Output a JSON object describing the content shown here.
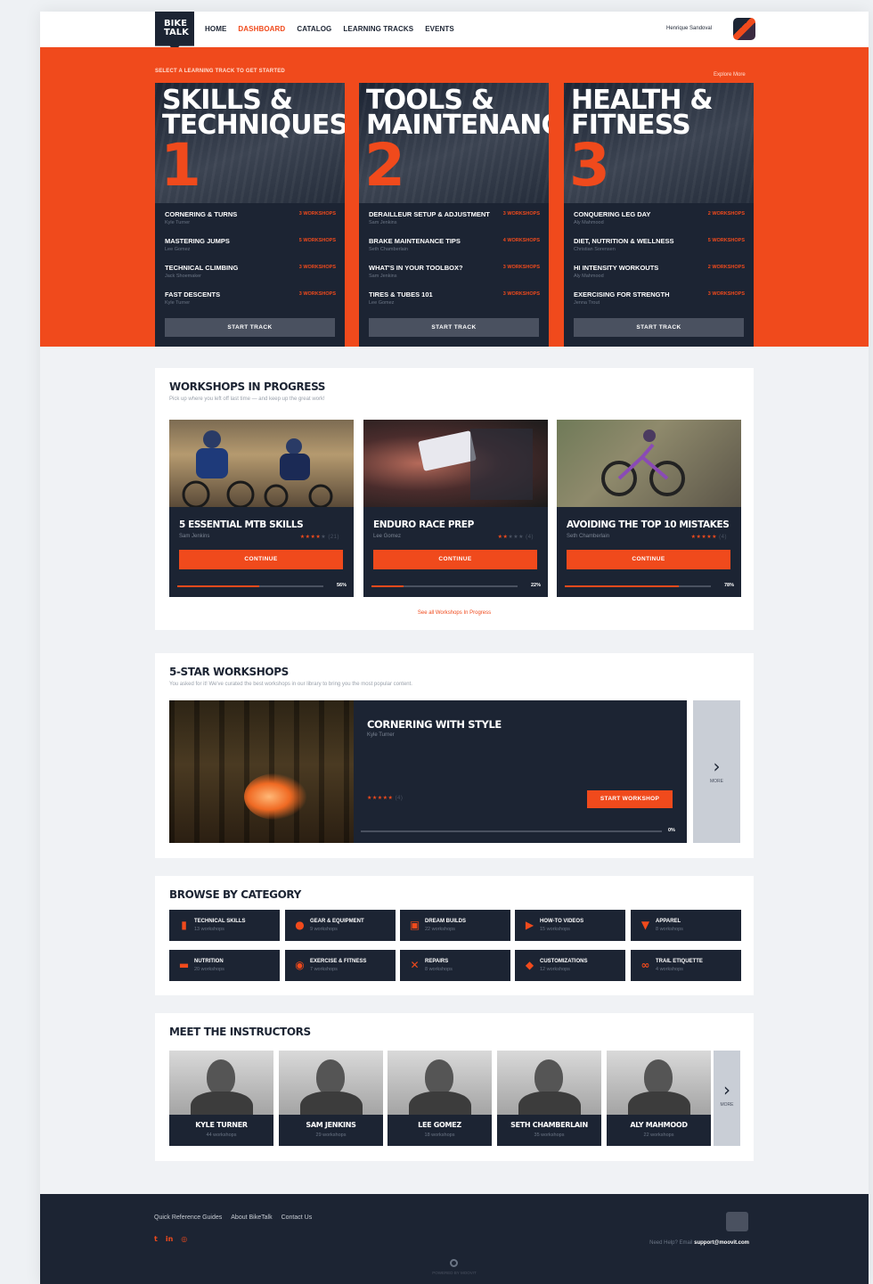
{
  "nav": {
    "logo_line1": "BIKE",
    "logo_line2": "TALK",
    "links": [
      "HOME",
      "DASHBOARD",
      "CATALOG",
      "LEARNING TRACKS",
      "EVENTS"
    ],
    "active_index": 1,
    "user_name": "Henrique Sandoval"
  },
  "hero": {
    "label": "SELECT A LEARNING TRACK TO GET STARTED",
    "explore": "Explore More",
    "tracks": [
      {
        "title_line1": "SKILLS &",
        "title_line2": "TECHNIQUES",
        "number": "1",
        "button": "START TRACK",
        "items": [
          {
            "title": "CORNERING & TURNS",
            "author": "Kyle Turner",
            "count": "3 WORKSHOPS"
          },
          {
            "title": "MASTERING JUMPS",
            "author": "Lee Gomez",
            "count": "5 WORKSHOPS"
          },
          {
            "title": "TECHNICAL CLIMBING",
            "author": "Jack Shoemaker",
            "count": "3 WORKSHOPS"
          },
          {
            "title": "FAST DESCENTS",
            "author": "Kyle Turner",
            "count": "3 WORKSHOPS"
          }
        ]
      },
      {
        "title_line1": "TOOLS &",
        "title_line2": "MAINTENANCE",
        "number": "2",
        "button": "START TRACK",
        "items": [
          {
            "title": "DERAILLEUR SETUP & ADJUSTMENT",
            "author": "Sam Jenkins",
            "count": "3 WORKSHOPS"
          },
          {
            "title": "BRAKE MAINTENANCE TIPS",
            "author": "Seth Chamberlain",
            "count": "4 WORKSHOPS"
          },
          {
            "title": "WHAT'S IN YOUR TOOLBOX?",
            "author": "Sam Jenkins",
            "count": "3 WORKSHOPS"
          },
          {
            "title": "TIRES & TUBES 101",
            "author": "Lee Gomez",
            "count": "3 WORKSHOPS"
          }
        ]
      },
      {
        "title_line1": "HEALTH &",
        "title_line2": "FITNESS",
        "number": "3",
        "button": "START TRACK",
        "items": [
          {
            "title": "CONQUERING LEG DAY",
            "author": "Aly Mahmood",
            "count": "2 WORKSHOPS"
          },
          {
            "title": "DIET, NUTRITION & WELLNESS",
            "author": "Christian Sorensen",
            "count": "5 WORKSHOPS"
          },
          {
            "title": "HI INTENSITY WORKOUTS",
            "author": "Aly Mahmood",
            "count": "2 WORKSHOPS"
          },
          {
            "title": "EXERCISING FOR STRENGTH",
            "author": "Jenna Trout",
            "count": "3 WORKSHOPS"
          }
        ]
      }
    ]
  },
  "in_progress": {
    "title": "WORKSHOPS IN PROGRESS",
    "subtitle": "Pick up where you left off last time — and keep up the great work!",
    "button": "CONTINUE",
    "see_all": "See all Workshops In Progress",
    "items": [
      {
        "title": "5 ESSENTIAL MTB SKILLS",
        "author": "Sam Jenkins",
        "stars": 4,
        "reviews": "(21)",
        "progress": 56,
        "progress_label": "56%"
      },
      {
        "title": "ENDURO RACE PREP",
        "author": "Lee Gomez",
        "stars": 2,
        "reviews": "(4)",
        "progress": 22,
        "progress_label": "22%"
      },
      {
        "title": "AVOIDING THE TOP 10 MISTAKES",
        "author": "Seth Chamberlain",
        "stars": 5,
        "reviews": "(4)",
        "progress": 78,
        "progress_label": "78%"
      }
    ]
  },
  "five_star": {
    "title": "5-STAR WORKSHOPS",
    "subtitle": "You asked for it! We've curated the best workshops in our library to bring you the most popular content.",
    "featured": {
      "title": "CORNERING WITH STYLE",
      "author": "Kyle Turner",
      "stars": 5,
      "reviews": "(4)",
      "button": "START WORKSHOP",
      "progress": 0,
      "progress_label": "0%"
    },
    "more_label": "MORE"
  },
  "categories": {
    "title": "BROWSE BY CATEGORY",
    "items": [
      {
        "name": "TECHNICAL SKILLS",
        "count": "13 workshops",
        "icon": "book-icon"
      },
      {
        "name": "GEAR & EQUIPMENT",
        "count": "9 workshops",
        "icon": "bag-icon"
      },
      {
        "name": "DREAM BUILDS",
        "count": "22 workshops",
        "icon": "frame-icon"
      },
      {
        "name": "HOW-TO VIDEOS",
        "count": "15 workshops",
        "icon": "video-icon"
      },
      {
        "name": "APPAREL",
        "count": "8 workshops",
        "icon": "shirt-icon"
      },
      {
        "name": "NUTRITION",
        "count": "20 workshops",
        "icon": "food-icon"
      },
      {
        "name": "EXERCISE & FITNESS",
        "count": "7 workshops",
        "icon": "stopwatch-icon"
      },
      {
        "name": "REPAIRS",
        "count": "8 workshops",
        "icon": "wrench-icon"
      },
      {
        "name": "CUSTOMIZATIONS",
        "count": "12 workshops",
        "icon": "paint-icon"
      },
      {
        "name": "TRAIL ETIQUETTE",
        "count": "4 workshops",
        "icon": "bike-icon"
      }
    ]
  },
  "instructors": {
    "title": "MEET THE INSTRUCTORS",
    "more_label": "MORE",
    "items": [
      {
        "name": "KYLE TURNER",
        "count": "44 workshops"
      },
      {
        "name": "SAM JENKINS",
        "count": "29 workshops"
      },
      {
        "name": "LEE GOMEZ",
        "count": "18 workshops"
      },
      {
        "name": "SETH CHAMBERLAIN",
        "count": "35 workshops"
      },
      {
        "name": "ALY MAHMOOD",
        "count": "22 workshops"
      }
    ]
  },
  "footer": {
    "links": [
      "Quick Reference Guides",
      "About BikeTalk",
      "Contact Us"
    ],
    "social": [
      "twitter-icon",
      "linkedin-icon",
      "instagram-icon"
    ],
    "help_text": "Need Help? Email",
    "help_email": "support@moovit.com",
    "powered": "POWERED BY MOOVIT"
  },
  "colors": {
    "accent": "#f04a1c",
    "navy": "#1c2433",
    "gray": "#4a5160"
  }
}
